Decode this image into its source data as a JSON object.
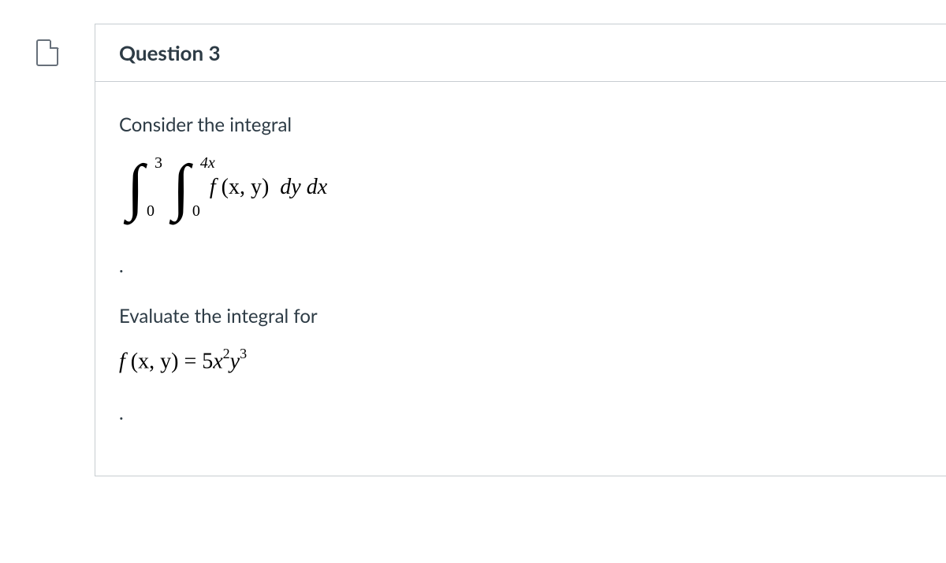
{
  "question": {
    "number_label": "Question 3",
    "prompt_line1": "Consider the integral",
    "integral": {
      "outer_lower": "0",
      "outer_upper": "3",
      "inner_lower": "0",
      "inner_upper": "4x",
      "integrand_f": "f",
      "integrand_args": "(x, y)",
      "dy": "dy",
      "dx": "dx"
    },
    "prompt_line2": "Evaluate the integral for",
    "function_def": {
      "lhs_f": "f",
      "lhs_args": "(x, y)",
      "equals": " = ",
      "coef": "5",
      "x": "x",
      "x_pow": "2",
      "y": "y",
      "y_pow": "3"
    },
    "dot": "."
  }
}
